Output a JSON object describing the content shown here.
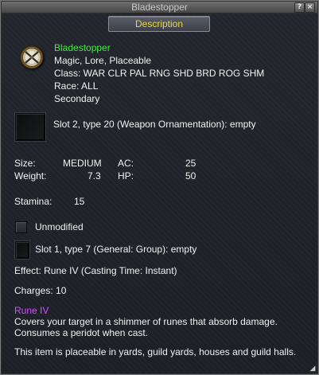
{
  "window": {
    "title": "Bladestopper",
    "help_glyph": "?",
    "close_glyph": "×"
  },
  "tab": {
    "label": "Description"
  },
  "item": {
    "name": "Bladestopper",
    "flags": "Magic, Lore, Placeable",
    "class_line": "Class: WAR CLR PAL RNG SHD BRD ROG SHM",
    "race_line": "Race: ALL",
    "slot_line": "Secondary",
    "icon": "round-shield-crossed-swords-icon"
  },
  "ornament_slot": {
    "text": "Slot 2, type 20 (Weapon Ornamentation): empty"
  },
  "stats": {
    "size_label": "Size:",
    "size_value": "MEDIUM",
    "weight_label": "Weight:",
    "weight_value": "7.3",
    "ac_label": "AC:",
    "ac_value": "25",
    "hp_label": "HP:",
    "hp_value": "50",
    "stamina_label": "Stamina:",
    "stamina_value": "15"
  },
  "modified": {
    "label": "Unmodified"
  },
  "aug_slot": {
    "text": "Slot 1, type 7 (General: Group): empty"
  },
  "effect_line": "Effect: Rune IV (Casting Time: Instant)",
  "charges_line": "Charges: 10",
  "spell": {
    "name": "Rune IV",
    "desc_line1": "Covers your target in a shimmer of runes that absorb damage.",
    "desc_line2": "Consumes a peridot when cast."
  },
  "placeable_note": "This item is placeable in yards, guild yards, houses and guild halls.",
  "colors": {
    "item_name": "#3cf03c",
    "spell_name": "#d24dff",
    "tab_label": "#e8d84a",
    "text": "#f2f2f2"
  }
}
